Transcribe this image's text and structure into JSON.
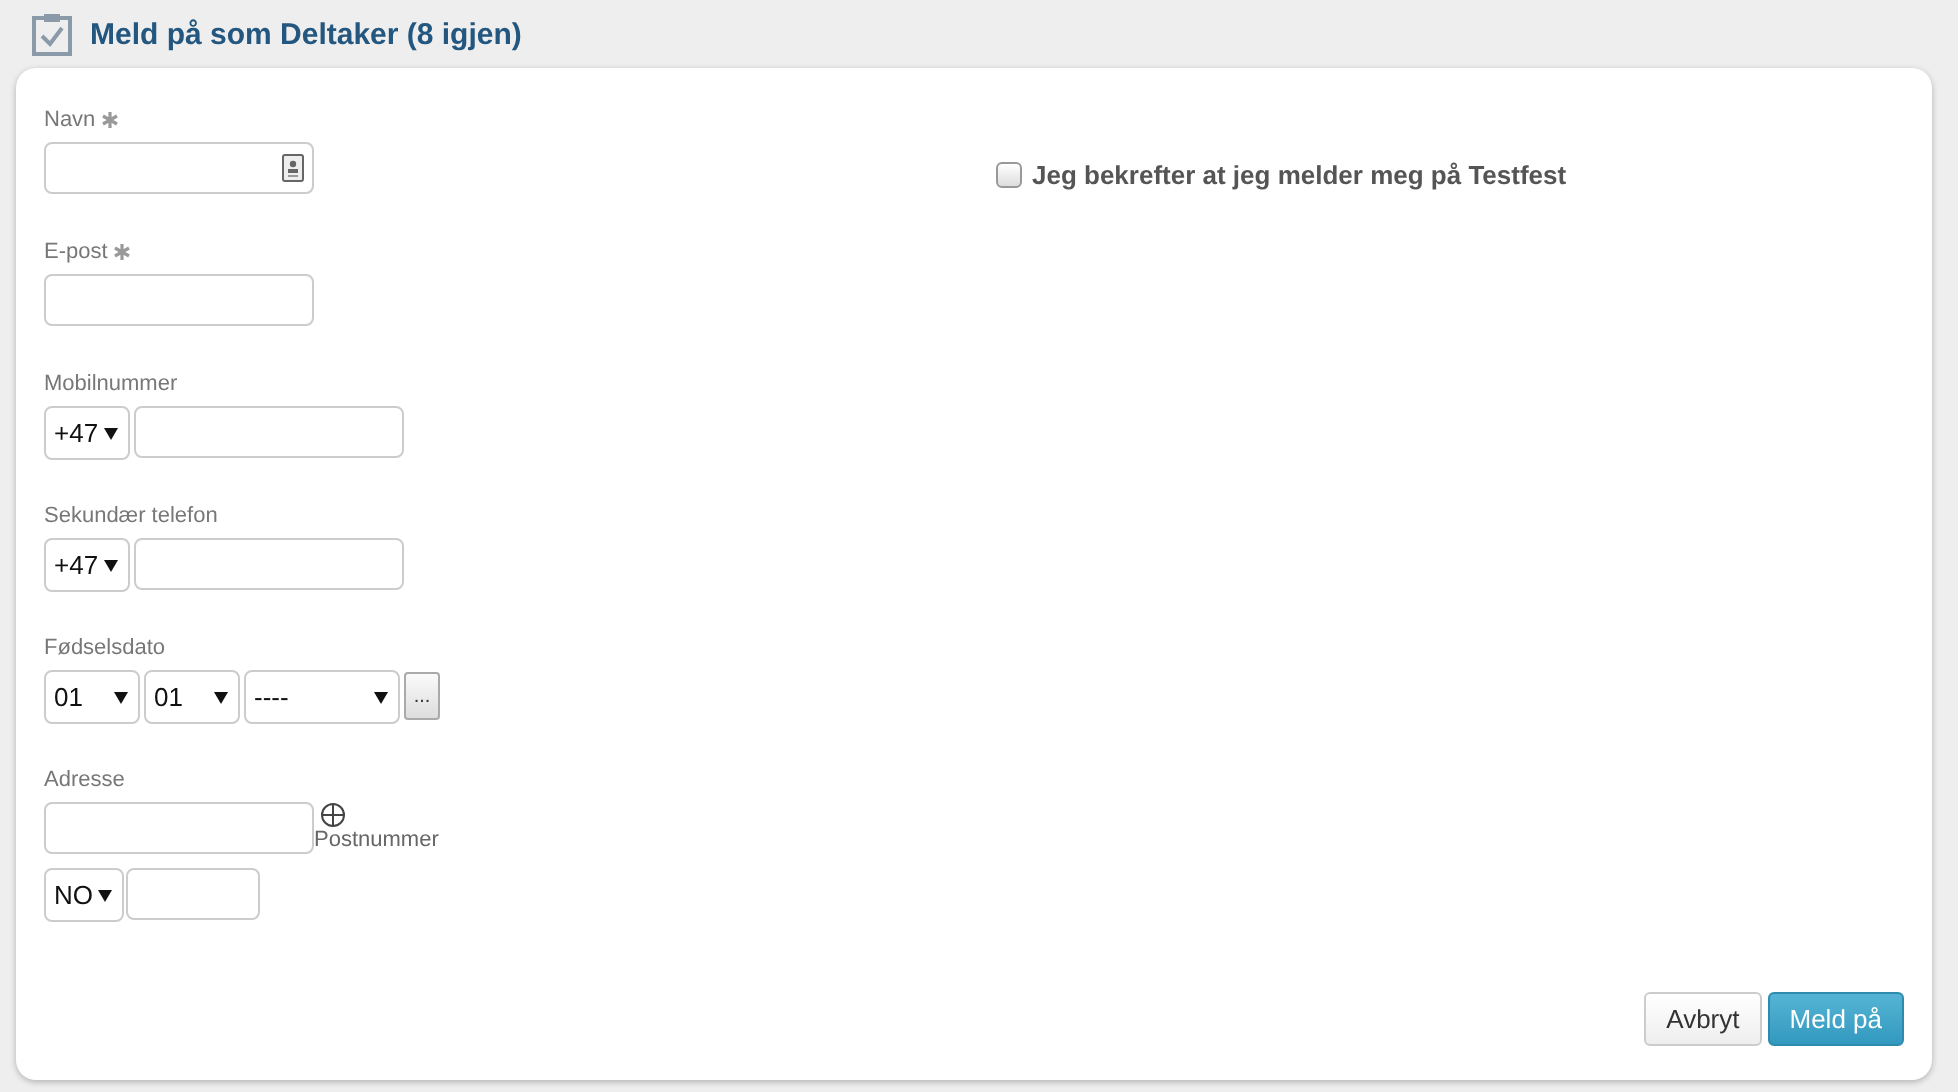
{
  "header": {
    "title": "Meld på som Deltaker (8 igjen)"
  },
  "fields": [
    {
      "kind": "text",
      "label": "Navn",
      "required": true,
      "contact_icon": true
    },
    {
      "kind": "text",
      "label": "E-post",
      "required": true
    },
    {
      "kind": "phone",
      "label": "Mobilnummer",
      "country_code": "+47"
    },
    {
      "kind": "phone",
      "label": "Sekundær telefon",
      "country_code": "+47"
    },
    {
      "kind": "date",
      "label": "Fødselsdato",
      "day": "01",
      "month": "01",
      "year": "----",
      "picker_button": "..."
    },
    {
      "kind": "address",
      "label": "Adresse",
      "postcode_label": "Postnummer",
      "country": "NO"
    }
  ],
  "confirm": {
    "label": "Jeg bekrefter at jeg melder meg på Testfest",
    "checked": false
  },
  "buttons": [
    {
      "label": "Avbryt",
      "kind": "secondary"
    },
    {
      "label": "Meld på",
      "kind": "primary"
    }
  ]
}
